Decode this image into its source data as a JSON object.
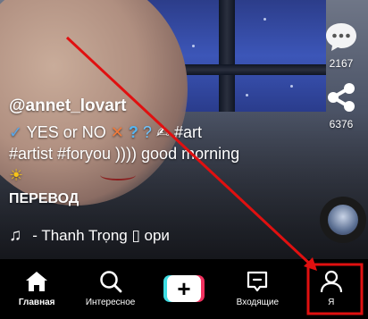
{
  "post": {
    "username": "@annet_lovart",
    "description_parts": {
      "check": "✓",
      "text1": " YES or NO ",
      "cross": "✕",
      "q1": " ?",
      "q2": " ?",
      "hand": " ✍ ",
      "text2": "#art",
      "line2": "#artist #foryou )))) good morning",
      "sun": "☀"
    },
    "translate_label": "ПЕРЕВОД",
    "music": "- Thanh Trọng ▯   ори"
  },
  "actions": {
    "comments_count": "2167",
    "shares_count": "6376"
  },
  "nav": {
    "home": "Главная",
    "discover": "Интересное",
    "create": "+",
    "inbox": "Входящие",
    "profile": "Я"
  },
  "colors": {
    "annotation_red": "#e01010",
    "create_cyan": "#3fdde3",
    "create_pink": "#f0315f"
  }
}
